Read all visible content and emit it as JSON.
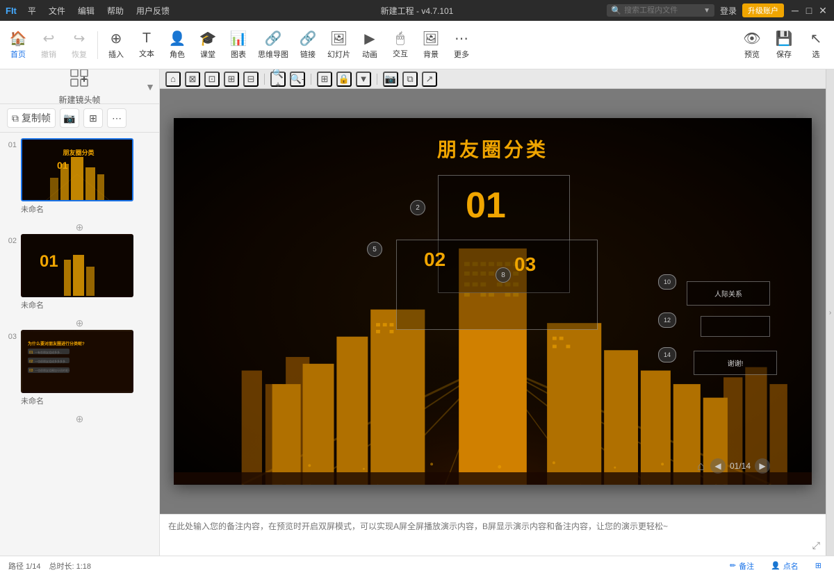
{
  "titlebar": {
    "app_name": "FIt",
    "menu_items": [
      "平",
      "文件",
      "编辑",
      "帮助",
      "用户反馈"
    ],
    "title": "新建工程 - v4.7.101",
    "search_placeholder": "搜索工程内文件",
    "login_label": "登录",
    "upgrade_label": "升级账户",
    "win_min": "─",
    "win_max": "□",
    "win_close": "✕"
  },
  "toolbar": {
    "home_label": "首页",
    "undo_label": "撤销",
    "redo_label": "恢复",
    "insert_label": "插入",
    "text_label": "文本",
    "role_label": "角色",
    "class_label": "课堂",
    "chart_label": "图表",
    "mindmap_label": "思维导图",
    "link_label": "链接",
    "slides_label": "幻灯片",
    "animate_label": "动画",
    "interact_label": "交互",
    "bg_label": "背景",
    "more_label": "更多",
    "preview_label": "预览",
    "save_label": "保存",
    "select_label": "选"
  },
  "sidebar": {
    "new_frame_label": "新建镜头帧",
    "copy_frame_label": "复制帧",
    "slides": [
      {
        "num": "01",
        "label": "未命名",
        "active": true
      },
      {
        "num": "02",
        "label": "未命名",
        "active": false
      },
      {
        "num": "03",
        "label": "未命名",
        "active": false
      }
    ]
  },
  "canvas": {
    "slide_title": "朋友圈分类",
    "num1": "01",
    "num2": "02",
    "num3": "03",
    "badge2": "2",
    "badge5": "5",
    "badge8": "8",
    "badge10": "10",
    "badge12": "12",
    "badge14": "14",
    "page_nav": "01/14",
    "box_label1": "人际关系",
    "box_label2": "谢谢!"
  },
  "notes": {
    "placeholder": "在此处输入您的备注内容，在预览时开启双屏模式，可以实现A屏全屏播放演示内容，B屏显示演示内容和备注内容，让您的演示更轻松~"
  },
  "bottombar": {
    "path": "路径 1/14",
    "duration": "总时长: 1:18",
    "notes_label": "备注",
    "callout_label": "点名"
  }
}
